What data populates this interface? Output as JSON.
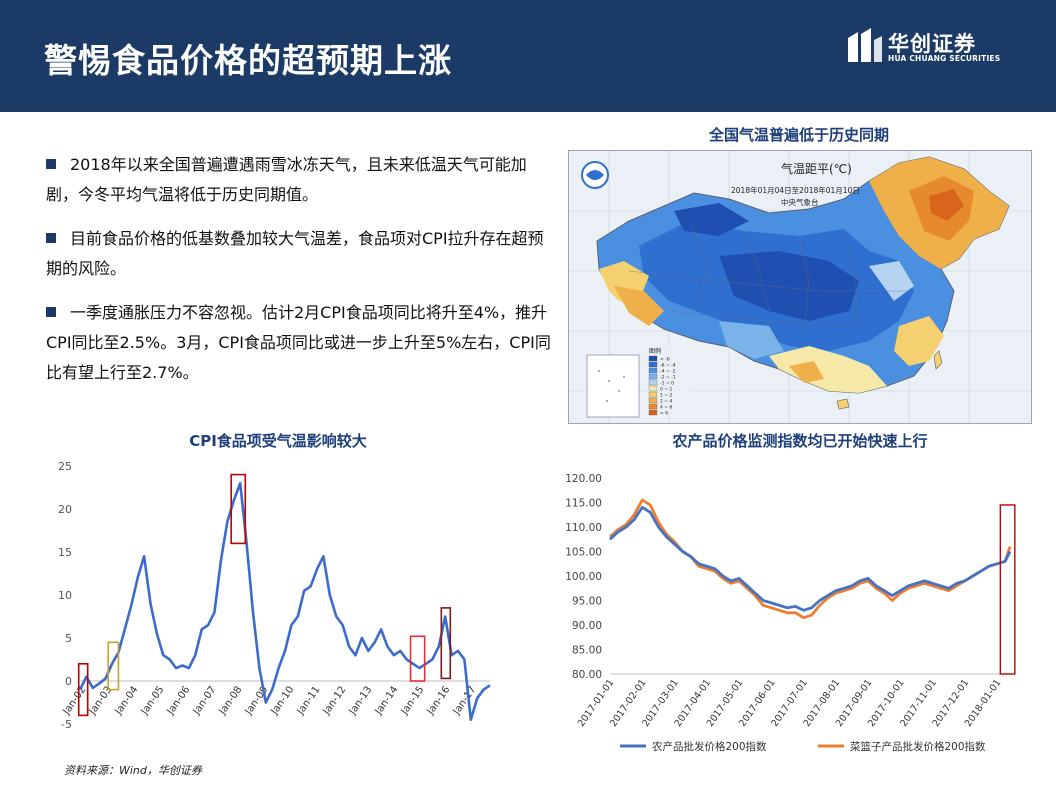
{
  "header": {
    "title": "警惕食品价格的超预期上涨"
  },
  "logo": {
    "cn": "华创证券",
    "en": "HUA CHUANG SECURITIES"
  },
  "bullets": [
    "2018年以来全国普遍遭遇雨雪冰冻天气，且未来低温天气可能加剧，今冬平均气温将低于历史同期值。",
    "目前食品价格的低基数叠加较大气温差，食品项对CPI拉升存在超预期的风险。",
    "一季度通胀压力不容忽视。估计2月CPI食品项同比将升至4%，推升CPI同比至2.5%。3月，CPI食品项同比或进一步上升至5%左右，CPI同比有望上行至2.7%。"
  ],
  "map": {
    "title": "全国气温普遍低于历史同期",
    "map_title": "气温距平(℃)",
    "date_range": "2018年01月04日至2018年01月10日",
    "agency": "中央气象台",
    "legend_title": "图例",
    "legend_items": [
      "< -6",
      "-6 ~ -4",
      "-4 ~ -2",
      "-2 ~ -1",
      "-1 ~ 0",
      "0 ~ 1",
      "1 ~ 2",
      "2 ~ 4",
      "4 ~ 6",
      "> 6"
    ],
    "legend_colors": [
      "#1f4fb0",
      "#2f6fd0",
      "#4a8fe0",
      "#7ab3ea",
      "#b4d4f2",
      "#f6e9a8",
      "#f4d070",
      "#efb04a",
      "#e68a2e",
      "#d9651c"
    ]
  },
  "source": "资料来源：Wind，华创证券",
  "chart_data": [
    {
      "type": "line",
      "title": "CPI食品项受气温影响较大",
      "xlabel": "",
      "ylabel": "",
      "ylim": [
        -5,
        25
      ],
      "yticks": [
        -5,
        0,
        5,
        10,
        15,
        20,
        25
      ],
      "ytick_labels": [
        "-5",
        "0",
        "5",
        "10",
        "15",
        "20",
        "25"
      ],
      "grid": false,
      "x_tick_labels": [
        "Jan-02",
        "Jan-03",
        "Jan-04",
        "Jan-05",
        "Jan-06",
        "Jan-07",
        "Jan-08",
        "Jan-09",
        "Jan-10",
        "Jan-11",
        "Jan-12",
        "Jan-13",
        "Jan-14",
        "Jan-15",
        "Jan-16",
        "Jan-17"
      ],
      "color": "#3b6ccc",
      "x": [
        2002.0,
        2002.25,
        2002.5,
        2002.75,
        2003.0,
        2003.25,
        2003.5,
        2003.75,
        2004.0,
        2004.25,
        2004.5,
        2004.75,
        2005.0,
        2005.25,
        2005.5,
        2005.75,
        2006.0,
        2006.25,
        2006.5,
        2006.75,
        2007.0,
        2007.25,
        2007.5,
        2007.75,
        2008.0,
        2008.25,
        2008.5,
        2008.75,
        2009.0,
        2009.25,
        2009.5,
        2009.75,
        2010.0,
        2010.25,
        2010.5,
        2010.75,
        2011.0,
        2011.25,
        2011.5,
        2011.75,
        2012.0,
        2012.25,
        2012.5,
        2012.75,
        2013.0,
        2013.25,
        2013.5,
        2013.75,
        2014.0,
        2014.25,
        2014.5,
        2014.75,
        2015.0,
        2015.25,
        2015.5,
        2015.75,
        2016.0,
        2016.25,
        2016.5,
        2016.75,
        2017.0,
        2017.25,
        2017.5,
        2017.75,
        2018.0
      ],
      "values": [
        -1.0,
        0.5,
        -0.8,
        -0.3,
        0.3,
        2.0,
        3.3,
        6.0,
        8.8,
        12.0,
        14.5,
        9.0,
        5.5,
        3.0,
        2.5,
        1.5,
        1.8,
        1.5,
        3.0,
        6.0,
        6.5,
        8.0,
        14.0,
        18.5,
        21.0,
        23.0,
        16.0,
        8.0,
        1.5,
        -2.5,
        -1.0,
        1.5,
        3.5,
        6.5,
        7.5,
        10.5,
        11.0,
        13.0,
        14.5,
        10.0,
        7.5,
        6.5,
        4.0,
        3.0,
        5.0,
        3.5,
        4.5,
        6.0,
        4.0,
        3.0,
        3.5,
        2.5,
        2.0,
        1.5,
        2.0,
        2.5,
        4.0,
        7.5,
        3.0,
        3.5,
        2.5,
        -4.5,
        -2.0,
        -1.0,
        -0.5
      ]
    },
    {
      "type": "line",
      "title": "农产品价格监测指数均已开始快速上行",
      "xlabel": "",
      "ylabel": "",
      "ylim": [
        80,
        120
      ],
      "yticks": [
        80,
        85,
        90,
        95,
        100,
        105,
        110,
        115,
        120
      ],
      "ytick_labels": [
        "80.00",
        "85.00",
        "90.00",
        "95.00",
        "100.00",
        "105.00",
        "110.00",
        "115.00",
        "120.00"
      ],
      "x_tick_labels": [
        "2017-01-01",
        "2017-02-01",
        "2017-03-01",
        "2017-04-01",
        "2017-05-01",
        "2017-06-01",
        "2017-07-01",
        "2017-08-01",
        "2017-09-01",
        "2017-10-01",
        "2017-11-01",
        "2017-12-01",
        "2018-01-01"
      ],
      "x": [
        0,
        0.25,
        0.5,
        0.75,
        1.0,
        1.25,
        1.5,
        1.75,
        2.0,
        2.25,
        2.5,
        2.75,
        3.0,
        3.25,
        3.5,
        3.75,
        4.0,
        4.25,
        4.5,
        4.75,
        5.0,
        5.25,
        5.5,
        5.75,
        6.0,
        6.25,
        6.5,
        6.75,
        7.0,
        7.25,
        7.5,
        7.75,
        8.0,
        8.25,
        8.5,
        8.75,
        9.0,
        9.25,
        9.5,
        9.75,
        10.0,
        10.25,
        10.5,
        10.75,
        11.0,
        11.25,
        11.5,
        11.75,
        12.0,
        12.25,
        12.4
      ],
      "series": [
        {
          "name": "农产品批发价格200指数",
          "color": "#4472c4",
          "values": [
            107.5,
            109.0,
            110.0,
            111.5,
            114.0,
            113.0,
            110.0,
            108.0,
            106.5,
            105.0,
            104.0,
            102.5,
            102.0,
            101.5,
            100.0,
            99.0,
            99.5,
            98.0,
            96.5,
            95.0,
            94.5,
            94.0,
            93.5,
            93.8,
            93.0,
            93.5,
            95.0,
            96.0,
            97.0,
            97.5,
            98.0,
            99.0,
            99.5,
            98.0,
            97.0,
            96.0,
            97.0,
            98.0,
            98.5,
            99.0,
            98.5,
            98.0,
            97.5,
            98.5,
            99.0,
            100.0,
            101.0,
            102.0,
            102.5,
            103.0,
            105.0
          ]
        },
        {
          "name": "菜篮子产品批发价格200指数",
          "color": "#ed7d31",
          "values": [
            108.0,
            109.5,
            110.5,
            112.5,
            115.5,
            114.5,
            111.0,
            108.5,
            107.0,
            105.0,
            104.0,
            102.0,
            101.5,
            101.0,
            99.5,
            98.5,
            99.0,
            97.5,
            96.0,
            94.0,
            93.5,
            93.0,
            92.5,
            92.5,
            91.5,
            92.0,
            94.0,
            95.5,
            96.5,
            97.0,
            97.5,
            98.5,
            99.0,
            97.5,
            96.5,
            95.0,
            96.5,
            97.5,
            98.0,
            98.5,
            98.0,
            97.5,
            97.0,
            98.0,
            99.0,
            100.0,
            101.0,
            102.0,
            102.5,
            103.0,
            106.0
          ]
        }
      ]
    }
  ]
}
